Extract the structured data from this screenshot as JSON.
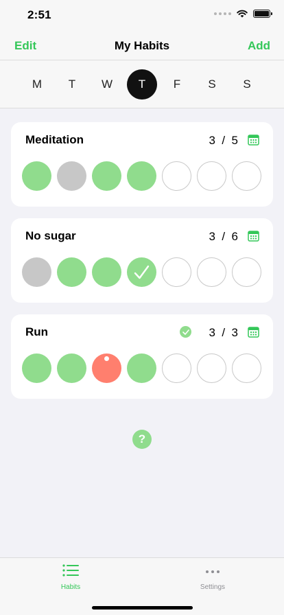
{
  "status_bar": {
    "time": "2:51"
  },
  "nav": {
    "left_label": "Edit",
    "title": "My Habits",
    "right_label": "Add",
    "accent_color": "#34c759"
  },
  "days": [
    {
      "label": "M",
      "selected": false
    },
    {
      "label": "T",
      "selected": false
    },
    {
      "label": "W",
      "selected": false
    },
    {
      "label": "T",
      "selected": true
    },
    {
      "label": "F",
      "selected": false
    },
    {
      "label": "S",
      "selected": false
    },
    {
      "label": "S",
      "selected": false
    }
  ],
  "habits": [
    {
      "name": "Meditation",
      "done": 3,
      "goal": 5,
      "count_text": "3  /  5",
      "goal_met": false,
      "week": [
        "done",
        "skip",
        "done",
        "done",
        "empty",
        "empty",
        "empty"
      ]
    },
    {
      "name": "No sugar",
      "done": 3,
      "goal": 6,
      "count_text": "3  /  6",
      "goal_met": false,
      "week": [
        "skip",
        "done",
        "done",
        "done-today",
        "empty",
        "empty",
        "empty"
      ]
    },
    {
      "name": "Run",
      "done": 3,
      "goal": 3,
      "count_text": "3  /  3",
      "goal_met": true,
      "week": [
        "done",
        "done",
        "missed",
        "done",
        "empty",
        "empty",
        "empty"
      ]
    }
  ],
  "icons": {
    "calendar": "calendar-icon",
    "goal_check": "checkmark-circle-icon",
    "help": "question-mark-icon",
    "habits_tab": "list-icon",
    "settings_tab": "ellipsis-icon"
  },
  "help": {
    "symbol": "?"
  },
  "tabs": [
    {
      "label": "Habits",
      "active": true
    },
    {
      "label": "Settings",
      "active": false
    }
  ],
  "colors": {
    "done": "#90dc8d",
    "skipped": "#c7c7c7",
    "missed": "#ff7f6e",
    "selected_day": "#111111"
  }
}
